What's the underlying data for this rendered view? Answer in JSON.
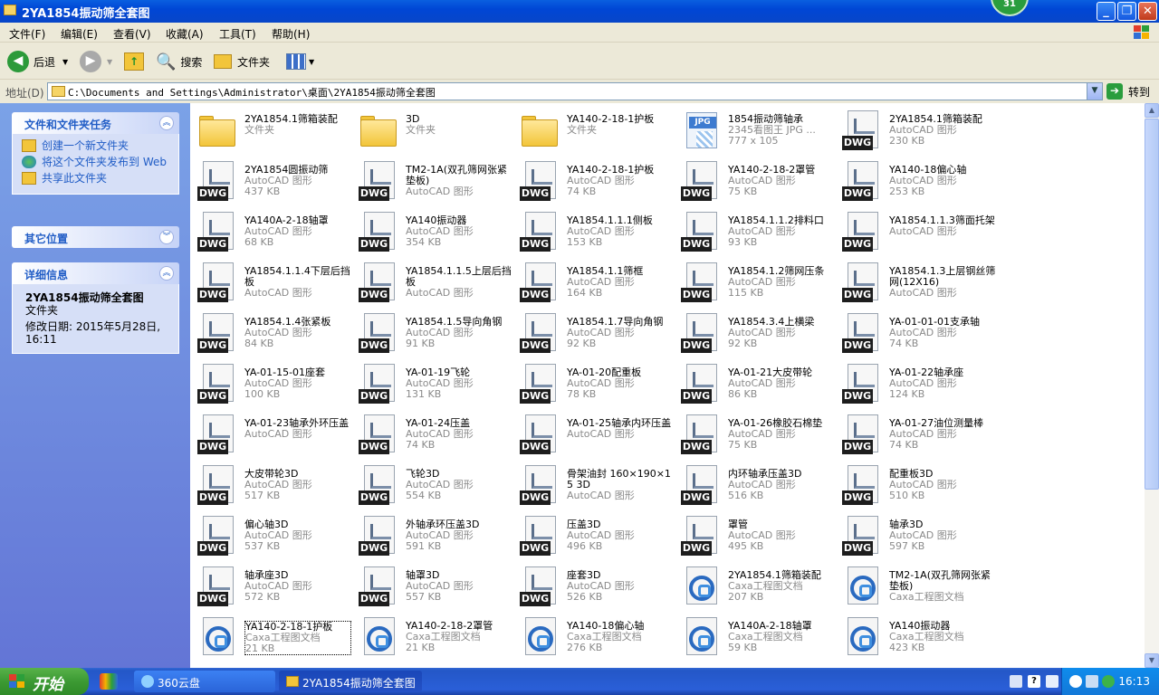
{
  "window": {
    "title": "2YA1854振动筛全套图",
    "badge": "31"
  },
  "menu": [
    "文件(F)",
    "编辑(E)",
    "查看(V)",
    "收藏(A)",
    "工具(T)",
    "帮助(H)"
  ],
  "toolbar": {
    "back": "后退",
    "search": "搜索",
    "folders": "文件夹"
  },
  "address": {
    "label": "地址(D)",
    "path": "C:\\Documents and Settings\\Administrator\\桌面\\2YA1854振动筛全套图",
    "go": "转到"
  },
  "sidebar": {
    "tasks": {
      "title": "文件和文件夹任务",
      "items": [
        "创建一个新文件夹",
        "将这个文件夹发布到 Web",
        "共享此文件夹"
      ]
    },
    "places": {
      "title": "其它位置"
    },
    "details": {
      "title": "详细信息",
      "name": "2YA1854振动筛全套图",
      "type": "文件夹",
      "modified": "修改日期: 2015年5月28日, 16:11"
    }
  },
  "files": [
    {
      "icon": "folder",
      "name": "2YA1854.1筛箱装配",
      "desc": "文件夹",
      "size": ""
    },
    {
      "icon": "folder",
      "name": "3D",
      "desc": "文件夹",
      "size": ""
    },
    {
      "icon": "folder",
      "name": "YA140-2-18-1护板",
      "desc": "文件夹",
      "size": ""
    },
    {
      "icon": "jpg",
      "name": "1854振动筛轴承",
      "desc": "2345看图王 JPG ...",
      "size": "777 x 105"
    },
    {
      "icon": "dwg",
      "name": "2YA1854.1筛箱装配",
      "desc": "AutoCAD 图形",
      "size": "230 KB"
    },
    {
      "icon": "dwg",
      "name": "2YA1854圆振动筛",
      "desc": "AutoCAD 图形",
      "size": "437 KB"
    },
    {
      "icon": "dwg",
      "name": "TM2-1A(双孔筛网张紧垫板)",
      "desc": "AutoCAD 图形",
      "size": ""
    },
    {
      "icon": "dwg",
      "name": "YA140-2-18-1护板",
      "desc": "AutoCAD 图形",
      "size": "74 KB"
    },
    {
      "icon": "dwg",
      "name": "YA140-2-18-2罩管",
      "desc": "AutoCAD 图形",
      "size": "75 KB"
    },
    {
      "icon": "dwg",
      "name": "YA140-18偏心轴",
      "desc": "AutoCAD 图形",
      "size": "253 KB"
    },
    {
      "icon": "dwg",
      "name": "YA140A-2-18轴罩",
      "desc": "AutoCAD 图形",
      "size": "68 KB"
    },
    {
      "icon": "dwg",
      "name": "YA140振动器",
      "desc": "AutoCAD 图形",
      "size": "354 KB"
    },
    {
      "icon": "dwg",
      "name": "YA1854.1.1.1侧板",
      "desc": "AutoCAD 图形",
      "size": "153 KB"
    },
    {
      "icon": "dwg",
      "name": "YA1854.1.1.2排料口",
      "desc": "AutoCAD 图形",
      "size": "93 KB"
    },
    {
      "icon": "dwg",
      "name": "YA1854.1.1.3筛面托架",
      "desc": "AutoCAD 图形",
      "size": ""
    },
    {
      "icon": "dwg",
      "name": "YA1854.1.1.4下层后挡板",
      "desc": "AutoCAD 图形",
      "size": ""
    },
    {
      "icon": "dwg",
      "name": "YA1854.1.1.5上层后挡板",
      "desc": "AutoCAD 图形",
      "size": ""
    },
    {
      "icon": "dwg",
      "name": "YA1854.1.1筛框",
      "desc": "AutoCAD 图形",
      "size": "164 KB"
    },
    {
      "icon": "dwg",
      "name": "YA1854.1.2筛网压条",
      "desc": "AutoCAD 图形",
      "size": "115 KB"
    },
    {
      "icon": "dwg",
      "name": "YA1854.1.3上层钢丝筛网(12X16)",
      "desc": "AutoCAD 图形",
      "size": ""
    },
    {
      "icon": "dwg",
      "name": "YA1854.1.4张紧板",
      "desc": "AutoCAD 图形",
      "size": "84 KB"
    },
    {
      "icon": "dwg",
      "name": "YA1854.1.5导向角钢",
      "desc": "AutoCAD 图形",
      "size": "91 KB"
    },
    {
      "icon": "dwg",
      "name": "YA1854.1.7导向角钢",
      "desc": "AutoCAD 图形",
      "size": "92 KB"
    },
    {
      "icon": "dwg",
      "name": "YA1854.3.4上横梁",
      "desc": "AutoCAD 图形",
      "size": "92 KB"
    },
    {
      "icon": "dwg",
      "name": "YA-01-01-01支承轴",
      "desc": "AutoCAD 图形",
      "size": "74 KB"
    },
    {
      "icon": "dwg",
      "name": "YA-01-15-01座套",
      "desc": "AutoCAD 图形",
      "size": "100 KB"
    },
    {
      "icon": "dwg",
      "name": "YA-01-19飞轮",
      "desc": "AutoCAD 图形",
      "size": "131 KB"
    },
    {
      "icon": "dwg",
      "name": "YA-01-20配重板",
      "desc": "AutoCAD 图形",
      "size": "78 KB"
    },
    {
      "icon": "dwg",
      "name": "YA-01-21大皮带轮",
      "desc": "AutoCAD 图形",
      "size": "86 KB"
    },
    {
      "icon": "dwg",
      "name": "YA-01-22轴承座",
      "desc": "AutoCAD 图形",
      "size": "124 KB"
    },
    {
      "icon": "dwg",
      "name": "YA-01-23轴承外环压盖",
      "desc": "AutoCAD 图形",
      "size": ""
    },
    {
      "icon": "dwg",
      "name": "YA-01-24压盖",
      "desc": "AutoCAD 图形",
      "size": "74 KB"
    },
    {
      "icon": "dwg",
      "name": "YA-01-25轴承内环压盖",
      "desc": "AutoCAD 图形",
      "size": ""
    },
    {
      "icon": "dwg",
      "name": "YA-01-26橡胶石棉垫",
      "desc": "AutoCAD 图形",
      "size": "75 KB"
    },
    {
      "icon": "dwg",
      "name": "YA-01-27油位测量棒",
      "desc": "AutoCAD 图形",
      "size": "74 KB"
    },
    {
      "icon": "dwg",
      "name": "大皮带轮3D",
      "desc": "AutoCAD 图形",
      "size": "517 KB"
    },
    {
      "icon": "dwg",
      "name": "飞轮3D",
      "desc": "AutoCAD 图形",
      "size": "554 KB"
    },
    {
      "icon": "dwg",
      "name": "骨架油封 160×190×15 3D",
      "desc": "AutoCAD 图形",
      "size": ""
    },
    {
      "icon": "dwg",
      "name": "内环轴承压盖3D",
      "desc": "AutoCAD 图形",
      "size": "516 KB"
    },
    {
      "icon": "dwg",
      "name": "配重板3D",
      "desc": "AutoCAD 图形",
      "size": "510 KB"
    },
    {
      "icon": "dwg",
      "name": "偏心轴3D",
      "desc": "AutoCAD 图形",
      "size": "537 KB"
    },
    {
      "icon": "dwg",
      "name": "外轴承环压盖3D",
      "desc": "AutoCAD 图形",
      "size": "591 KB"
    },
    {
      "icon": "dwg",
      "name": "压盖3D",
      "desc": "AutoCAD 图形",
      "size": "496 KB"
    },
    {
      "icon": "dwg",
      "name": "罩管",
      "desc": "AutoCAD 图形",
      "size": "495 KB"
    },
    {
      "icon": "dwg",
      "name": "轴承3D",
      "desc": "AutoCAD 图形",
      "size": "597 KB"
    },
    {
      "icon": "dwg",
      "name": "轴承座3D",
      "desc": "AutoCAD 图形",
      "size": "572 KB"
    },
    {
      "icon": "dwg",
      "name": "轴罩3D",
      "desc": "AutoCAD 图形",
      "size": "557 KB"
    },
    {
      "icon": "dwg",
      "name": "座套3D",
      "desc": "AutoCAD 图形",
      "size": "526 KB"
    },
    {
      "icon": "caxa",
      "name": "2YA1854.1筛箱装配",
      "desc": "Caxa工程图文档",
      "size": "207 KB"
    },
    {
      "icon": "caxa",
      "name": "TM2-1A(双孔筛网张紧垫板)",
      "desc": "Caxa工程图文档",
      "size": ""
    },
    {
      "icon": "caxa",
      "name": "YA140-2-18-1护板",
      "desc": "Caxa工程图文档",
      "size": "21 KB",
      "selected": true
    },
    {
      "icon": "caxa",
      "name": "YA140-2-18-2罩管",
      "desc": "Caxa工程图文档",
      "size": "21 KB"
    },
    {
      "icon": "caxa",
      "name": "YA140-18偏心轴",
      "desc": "Caxa工程图文档",
      "size": "276 KB"
    },
    {
      "icon": "caxa",
      "name": "YA140A-2-18轴罩",
      "desc": "Caxa工程图文档",
      "size": "59 KB"
    },
    {
      "icon": "caxa",
      "name": "YA140振动器",
      "desc": "Caxa工程图文档",
      "size": "423 KB"
    }
  ],
  "taskbar": {
    "start": "开始",
    "tasks": [
      "360云盘",
      "2YA1854振动筛全套图"
    ],
    "time": "16:13"
  }
}
